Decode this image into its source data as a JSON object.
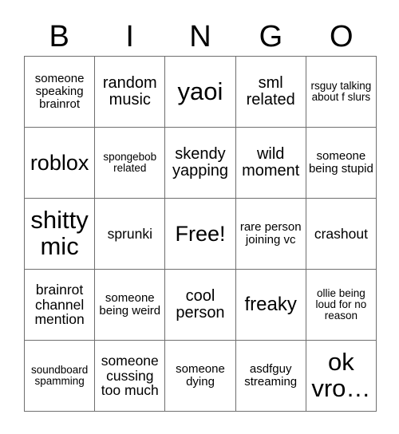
{
  "card": {
    "title_letters": [
      "B",
      "I",
      "N",
      "G",
      "O"
    ],
    "columns": 5,
    "rows": 5,
    "border_color": "#6f6f6f",
    "background_color": "#ffffff",
    "text_color": "#000000",
    "free_space_index": 12,
    "cells": [
      {
        "text": "someone speaking brainrot",
        "size": "s"
      },
      {
        "text": "random music",
        "size": "l"
      },
      {
        "text": "yaoi",
        "size": "huge"
      },
      {
        "text": "sml related",
        "size": "l"
      },
      {
        "text": "rsguy talking about f slurs",
        "size": "xs"
      },
      {
        "text": "roblox",
        "size": "xxl"
      },
      {
        "text": "spongebob related",
        "size": "xs"
      },
      {
        "text": "skendy yapping",
        "size": "l"
      },
      {
        "text": "wild moment",
        "size": "l"
      },
      {
        "text": "someone being stupid",
        "size": "s"
      },
      {
        "text": "shitty mic",
        "size": "huge"
      },
      {
        "text": "sprunki",
        "size": "m"
      },
      {
        "text": "Free!",
        "size": "xxl"
      },
      {
        "text": "rare person joining vc",
        "size": "s"
      },
      {
        "text": "crashout",
        "size": "m"
      },
      {
        "text": "brainrot channel mention",
        "size": "m"
      },
      {
        "text": "someone being weird",
        "size": "s"
      },
      {
        "text": "cool person",
        "size": "l"
      },
      {
        "text": "freaky",
        "size": "xl"
      },
      {
        "text": "ollie being loud for no reason",
        "size": "xs"
      },
      {
        "text": "soundboard spamming",
        "size": "xs"
      },
      {
        "text": "someone cussing too much",
        "size": "m"
      },
      {
        "text": "someone dying",
        "size": "s"
      },
      {
        "text": "asdfguy streaming",
        "size": "s"
      },
      {
        "text": "ok vro…",
        "size": "huge"
      }
    ]
  }
}
